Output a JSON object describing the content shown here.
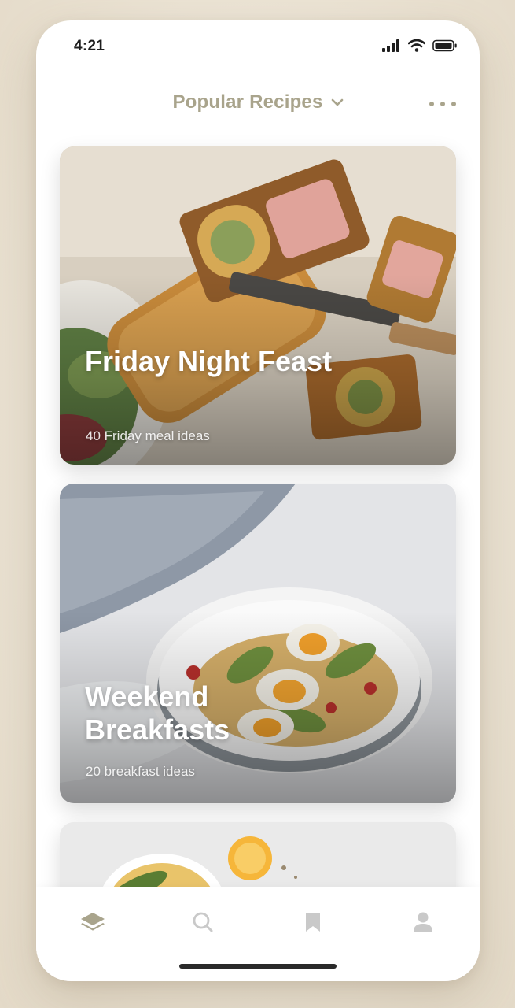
{
  "status_bar": {
    "time": "4:21"
  },
  "header": {
    "title": "Popular Recipes"
  },
  "cards": [
    {
      "title": "Friday Night Feast",
      "subtitle": "40 Friday meal ideas"
    },
    {
      "title": "Weekend Breakfasts",
      "subtitle": "20 breakfast ideas"
    }
  ],
  "tab_bar": {
    "items": [
      "stack-icon",
      "search-icon",
      "bookmark-icon",
      "profile-icon"
    ],
    "active": "stack-icon"
  },
  "colors": {
    "accent": "#a9a48c",
    "active_tab": "#a9a48c",
    "inactive_tab": "#c9c9c9",
    "background": "#ebe3d4"
  }
}
